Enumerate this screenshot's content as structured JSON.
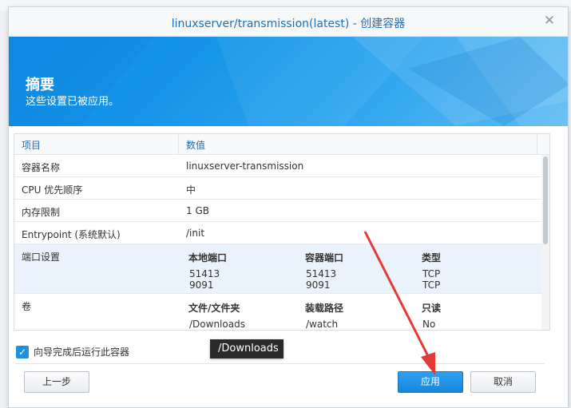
{
  "window": {
    "title": "linuxserver/transmission(latest) - 创建容器",
    "close_glyph": "✕"
  },
  "banner": {
    "title": "摘要",
    "subtitle": "这些设置已被应用。"
  },
  "summary": {
    "col_item": "项目",
    "col_value": "数值",
    "rows": [
      {
        "key": "容器名称",
        "value": "linuxserver-transmission"
      },
      {
        "key": "CPU 优先顺序",
        "value": "中"
      },
      {
        "key": "内存限制",
        "value": "1 GB"
      },
      {
        "key": "Entrypoint (系统默认)",
        "value": "/init"
      }
    ],
    "ports": {
      "key": "端口设置",
      "headers": [
        "本地端口",
        "容器端口",
        "类型"
      ],
      "rows": [
        [
          "51413",
          "51413",
          "TCP"
        ],
        [
          "9091",
          "9091",
          "TCP"
        ]
      ]
    },
    "volumes": {
      "key": "卷",
      "headers": [
        "文件/文件夹",
        "装载路径",
        "只读"
      ],
      "rows": [
        [
          "/Downloads",
          "/watch",
          "No"
        ]
      ]
    }
  },
  "checkbox": {
    "label": "向导完成后运行此容器",
    "checked": true
  },
  "tooltip": "/Downloads",
  "buttons": {
    "back": "上一步",
    "apply": "应用",
    "cancel": "取消"
  },
  "colors": {
    "accent": "#1f8fe0",
    "title": "#1f6fb5",
    "arrow": "#e53935"
  }
}
